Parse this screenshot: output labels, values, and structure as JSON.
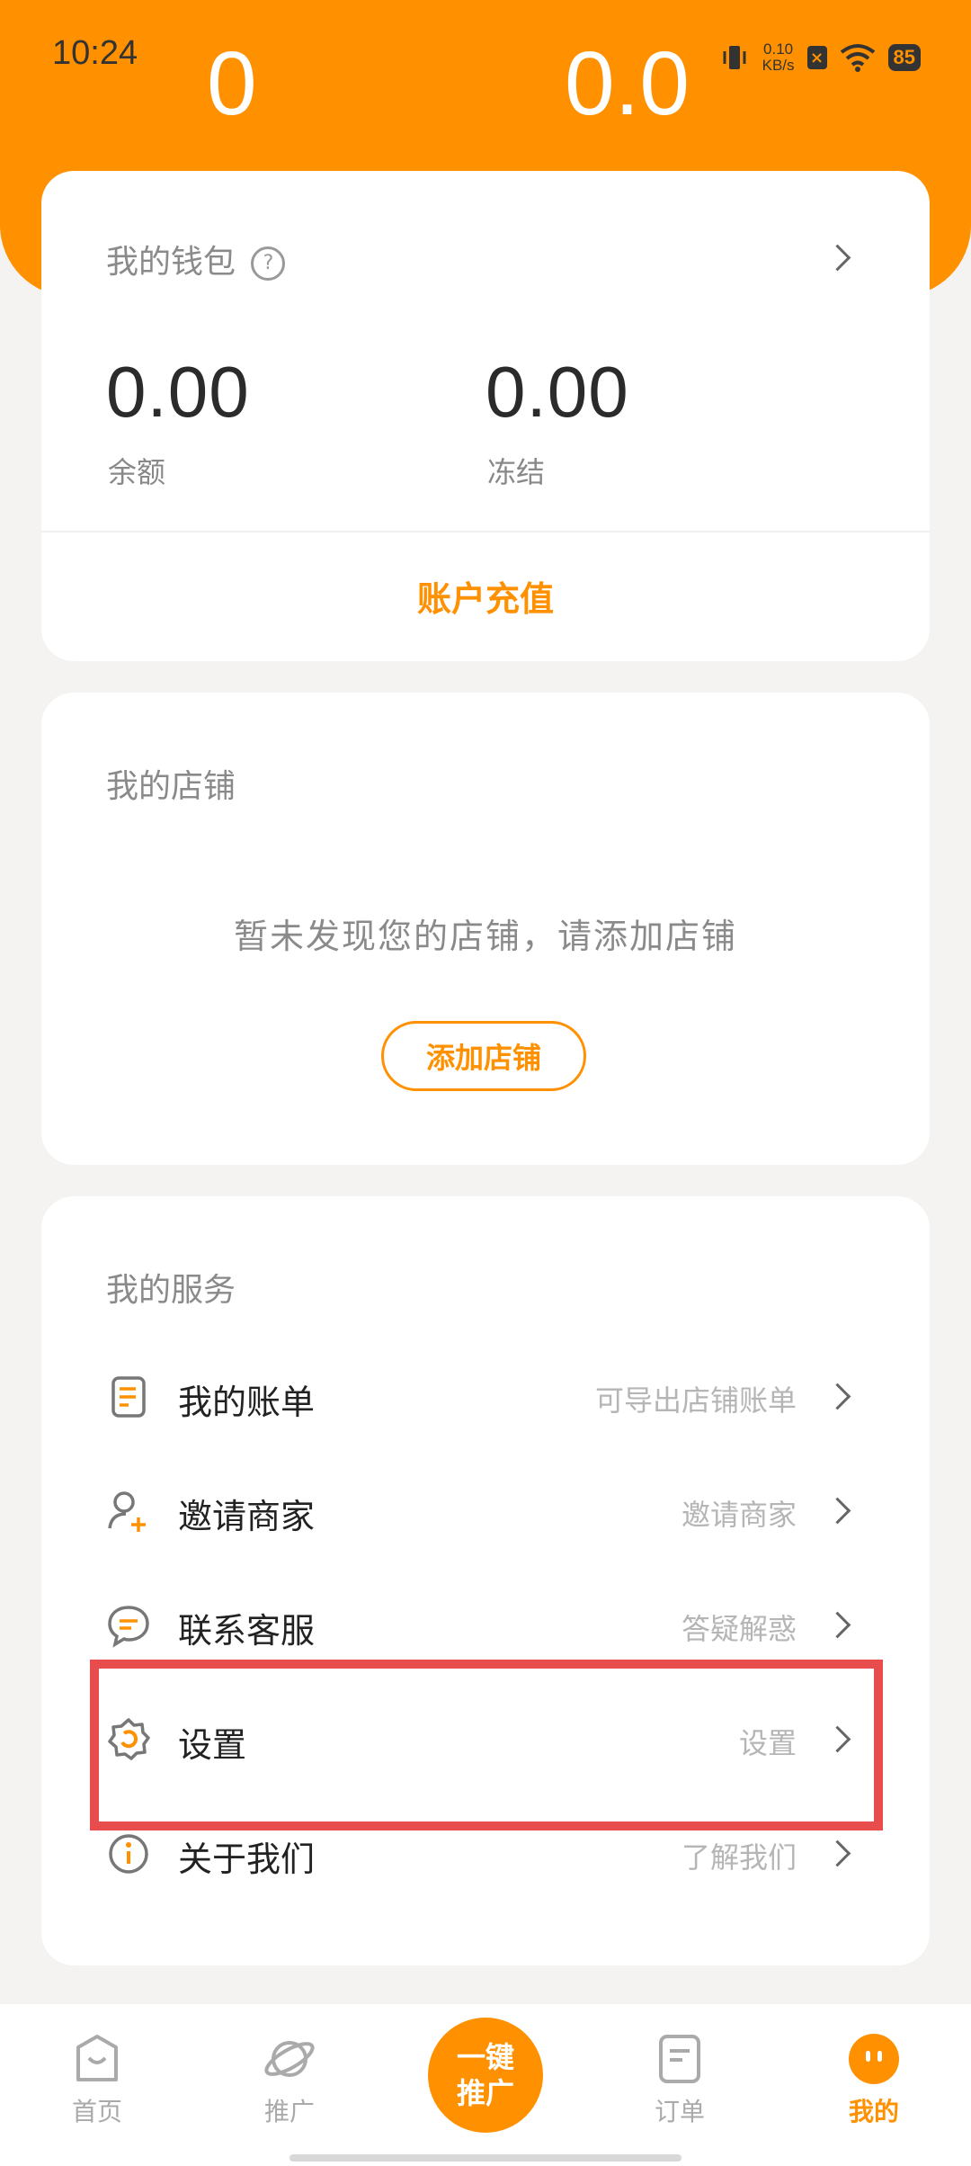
{
  "status_bar": {
    "time": "10:24",
    "net_speed_value": "0.10",
    "net_speed_unit": "KB/s",
    "battery": "85"
  },
  "header": {
    "left_value": "0",
    "right_value": "0.0"
  },
  "wallet": {
    "title": "我的钱包",
    "help_glyph": "?",
    "balance_value": "0.00",
    "balance_label": "余额",
    "frozen_value": "0.00",
    "frozen_label": "冻结",
    "recharge_label": "账户充值"
  },
  "store": {
    "title": "我的店铺",
    "empty_text": "暂未发现您的店铺，请添加店铺",
    "add_button": "添加店铺"
  },
  "services": {
    "title": "我的服务",
    "items": [
      {
        "label": "我的账单",
        "desc": "可导出店铺账单",
        "icon": "bill-icon"
      },
      {
        "label": "邀请商家",
        "desc": "邀请商家",
        "icon": "invite-user-icon"
      },
      {
        "label": "联系客服",
        "desc": "答疑解惑",
        "icon": "chat-icon"
      },
      {
        "label": "设置",
        "desc": "设置",
        "icon": "gear-icon"
      },
      {
        "label": "关于我们",
        "desc": "了解我们",
        "icon": "info-icon"
      }
    ]
  },
  "bottom_nav": {
    "home": "首页",
    "promote": "推广",
    "center_line1": "一键",
    "center_line2": "推广",
    "orders": "订单",
    "mine": "我的"
  },
  "colors": {
    "accent": "#ff9000",
    "highlight": "#e84c4c"
  }
}
